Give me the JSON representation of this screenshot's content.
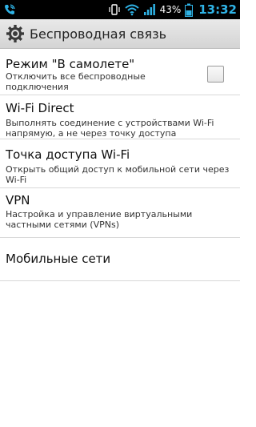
{
  "status_bar": {
    "battery_percent": "43%",
    "time": "13:32",
    "accent_color": "#2fb3e6"
  },
  "header": {
    "title": "Беспроводная связь",
    "icon": "gear-icon"
  },
  "items": [
    {
      "title": "Режим \"В самолете\"",
      "subtitle": "Отключить все беспроводные подключения",
      "checked": false
    },
    {
      "title": "Wi-Fi Direct",
      "subtitle": "Выполнять соединение  с устройствами Wi-Fi напрямую, а не через точку доступа"
    },
    {
      "title": "Точка доступа Wi-Fi",
      "subtitle": "Открыть общий доступ к мобильной сети через Wi-Fi"
    },
    {
      "title": "VPN",
      "subtitle": "Настройка и управление виртуальными частными сетями (VPNs)"
    },
    {
      "title": "Мобильные сети"
    }
  ]
}
